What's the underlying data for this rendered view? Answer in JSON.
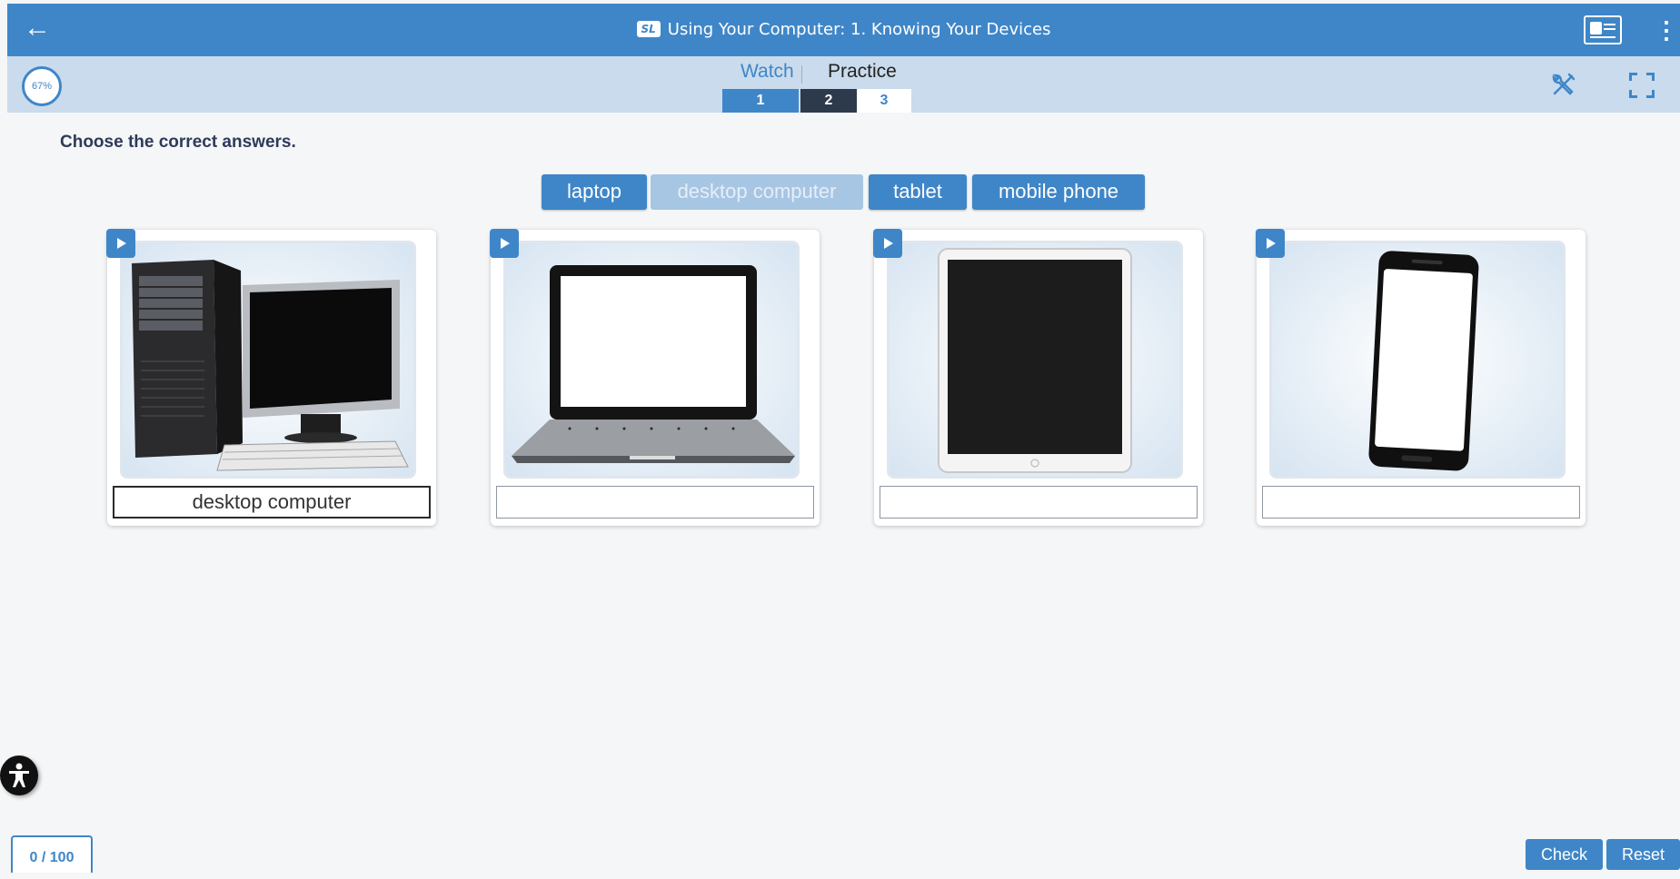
{
  "header": {
    "badge": "SL",
    "title": "Using Your Computer: 1. Knowing Your Devices",
    "back_icon": "arrow-left-icon"
  },
  "subbar": {
    "progress": "67%",
    "progress_value": 0.67,
    "tabs": {
      "watch": "Watch",
      "practice": "Practice"
    },
    "steps": [
      "1",
      "2",
      "3"
    ],
    "active_step": "2"
  },
  "instruction": "Choose the correct answers.",
  "word_bank": [
    {
      "label": "laptop",
      "used": false
    },
    {
      "label": "desktop computer",
      "used": true
    },
    {
      "label": "tablet",
      "used": false
    },
    {
      "label": "mobile phone",
      "used": false
    }
  ],
  "cards": [
    {
      "image": "desktop-computer",
      "answer": "desktop computer"
    },
    {
      "image": "laptop",
      "answer": ""
    },
    {
      "image": "tablet",
      "answer": ""
    },
    {
      "image": "mobile-phone",
      "answer": ""
    }
  ],
  "footer": {
    "score": "0 / 100",
    "check_label": "Check",
    "reset_label": "Reset"
  },
  "colors": {
    "primary": "#3f86c8",
    "subbar": "#c9dbec",
    "active_step": "#2c3a4b"
  }
}
